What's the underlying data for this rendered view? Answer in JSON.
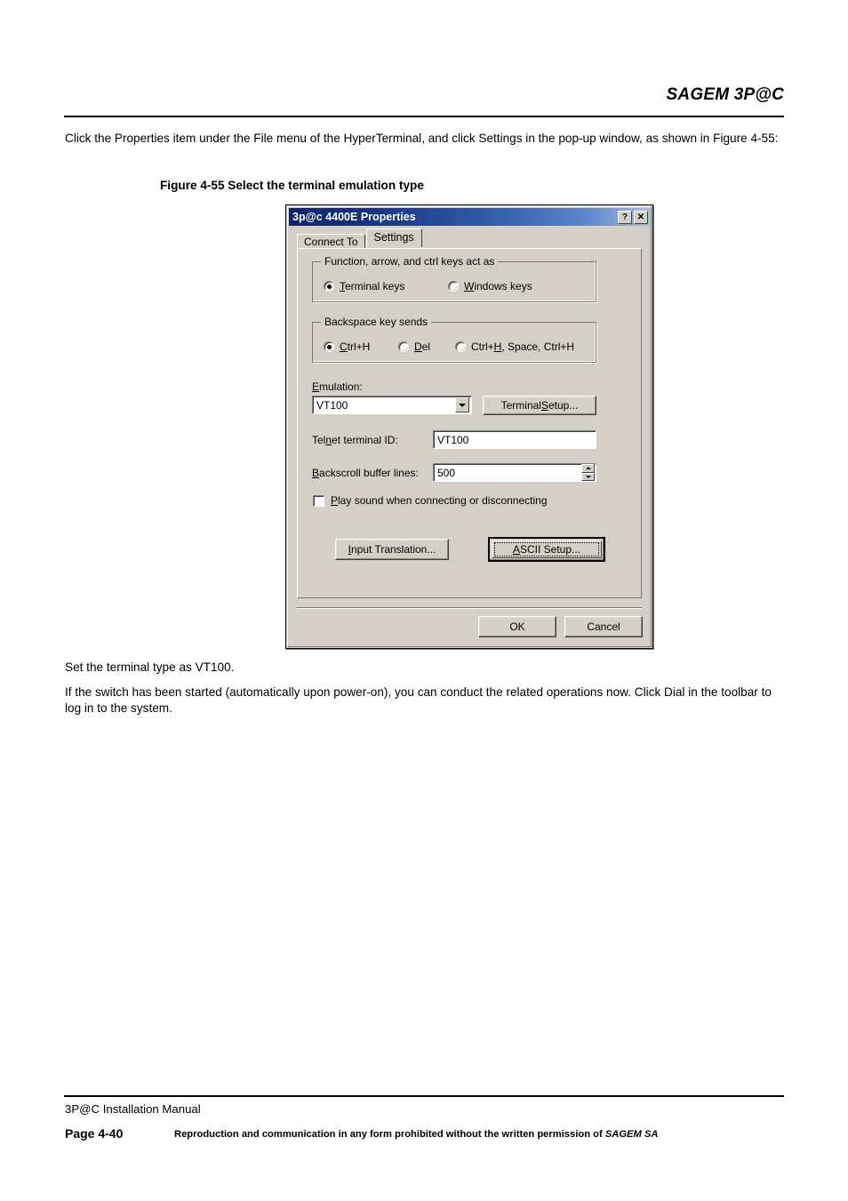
{
  "header": {
    "brand": "SAGEM 3P@C"
  },
  "body": {
    "intro": "Click the Properties item under the File menu of the HyperTerminal, and click Settings in the pop-up window, as shown in Figure 4-55:",
    "figure_caption": "Figure 4-55 Select the terminal emulation type",
    "after_1": "Set the terminal type as VT100.",
    "after_2": "If the switch has been started (automatically upon power-on), you can conduct the related operations now. Click Dial in the toolbar to log in to the system."
  },
  "dialog": {
    "title": "3p@c 4400E Properties",
    "help_button": "?",
    "close_button": "✕",
    "tabs": [
      {
        "label": "Connect To",
        "active": false
      },
      {
        "label": "Settings",
        "active": true
      }
    ],
    "group_keys": {
      "title": "Function, arrow, and ctrl keys act as",
      "options": [
        {
          "label_pre": "",
          "label_acc": "T",
          "label_post": "erminal keys",
          "selected": true
        },
        {
          "label_pre": "",
          "label_acc": "W",
          "label_post": "indows keys",
          "selected": false
        }
      ]
    },
    "group_backspace": {
      "title": "Backspace key sends",
      "options": [
        {
          "label_pre": "",
          "label_acc": "C",
          "label_post": "trl+H",
          "selected": true
        },
        {
          "label_pre": "",
          "label_acc": "D",
          "label_post": "el",
          "selected": false
        },
        {
          "label_pre": "Ctrl+",
          "label_acc": "H",
          "label_post": ", Space, Ctrl+H",
          "selected": false
        }
      ]
    },
    "emulation": {
      "label_pre": "",
      "label_acc": "E",
      "label_post": "mulation:",
      "value": "VT100",
      "terminal_setup_pre": "Terminal ",
      "terminal_setup_acc": "S",
      "terminal_setup_post": "etup..."
    },
    "telnet_id": {
      "label_pre": "Tel",
      "label_acc": "n",
      "label_post": "et terminal ID:",
      "value": "VT100"
    },
    "backscroll": {
      "label_pre": "",
      "label_acc": "B",
      "label_post": "ackscroll buffer lines:",
      "value": "500"
    },
    "play_sound": {
      "label_pre": "",
      "label_acc": "P",
      "label_post": "lay sound when connecting or disconnecting",
      "checked": false
    },
    "input_translation": {
      "label_pre": "",
      "label_acc": "I",
      "label_post": "nput Translation..."
    },
    "ascii_setup": {
      "label_pre": "",
      "label_acc": "A",
      "label_post": "SCII Setup...",
      "focused": true
    },
    "ok_label": "OK",
    "cancel_label": "Cancel"
  },
  "footer": {
    "manual": "3P@C Installation Manual",
    "page": "Page 4-40",
    "copyright_pre": "Reproduction and communication in any form prohibited without the written permission of ",
    "copyright_company": "SAGEM SA"
  },
  "colors": {
    "dialog_face": "#d4d0c8",
    "titlebar_start": "#0a246a",
    "titlebar_end": "#a6bede",
    "page_bg": "#ffffff",
    "text": "#000000"
  }
}
